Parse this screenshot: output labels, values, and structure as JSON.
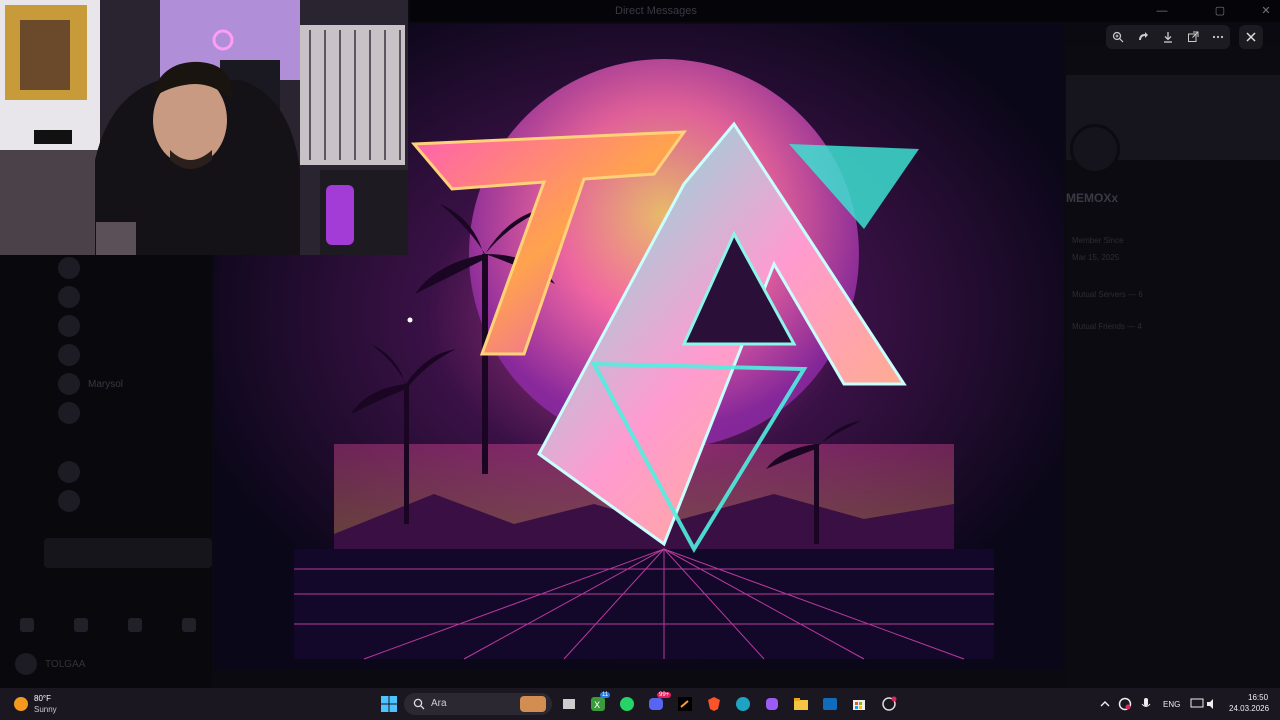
{
  "window": {
    "title": "Direct Messages",
    "controls": [
      "—",
      "▢",
      "✕"
    ]
  },
  "sidebar": {
    "dms": [
      {
        "name": "",
        "sub": ""
      },
      {
        "name": "",
        "sub": ""
      },
      {
        "name": "",
        "sub": ""
      },
      {
        "name": "",
        "sub": ""
      },
      {
        "name": "Marysol",
        "sub": ""
      },
      {
        "name": "",
        "sub": ""
      },
      {
        "name": "",
        "sub": ""
      },
      {
        "name": "",
        "sub": ""
      }
    ],
    "user": {
      "name": "TOLGAA"
    }
  },
  "profile": {
    "name": "MEMOXx",
    "member_since_label": "Member Since",
    "member_since": "Mar 15, 2025",
    "mutual_servers": "Mutual Servers — 6",
    "mutual_friends": "Mutual Friends — 4"
  },
  "viewer": {
    "tools": [
      "zoom-in-icon",
      "rotate-icon",
      "download-icon",
      "open-external-icon",
      "more-icon"
    ]
  },
  "taskbar": {
    "weather": {
      "temp": "80°F",
      "condition": "Sunny"
    },
    "search_placeholder": "Ara",
    "xbox_badge": "11",
    "discord_badge": "99+",
    "language": "ENG",
    "time": "16:50",
    "date": "24.03.2026"
  },
  "colors": {
    "accent": "#e94cc2",
    "neon_cyan": "#34e6d6",
    "neon_pink": "#ff4fa6",
    "neon_orange": "#ff9a3c",
    "taskbar": "#1a1720"
  }
}
